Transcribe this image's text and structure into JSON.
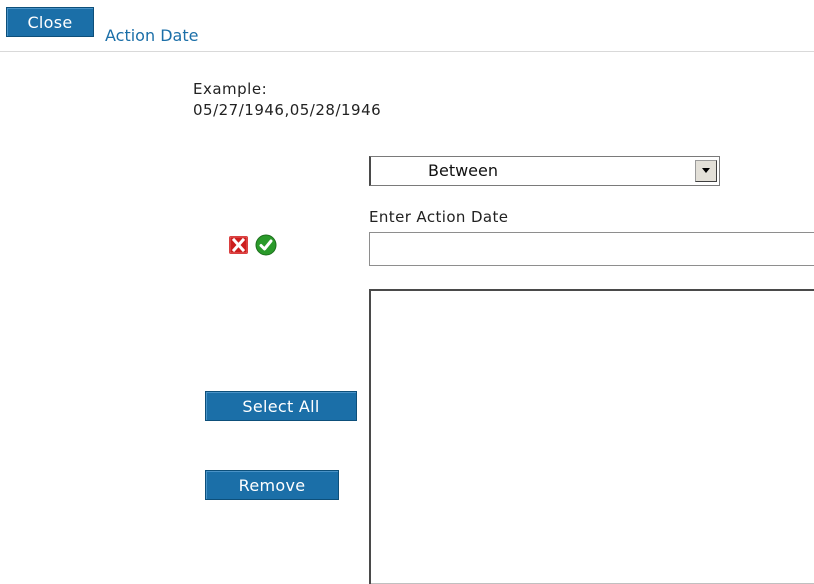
{
  "header": {
    "close_label": "Close",
    "title": "Action Date"
  },
  "filter": {
    "example_line1": "Example:",
    "example_line2": "05/27/1946,05/28/1946",
    "operator_selected": "Between",
    "input_label": "Enter Action Date",
    "input_value": "",
    "input_placeholder": ""
  },
  "icons": {
    "clear": "close-icon",
    "confirm": "check-icon"
  },
  "list": {
    "items": []
  },
  "buttons": {
    "select_all_label": "Select All",
    "remove_label": "Remove"
  },
  "colors": {
    "accent": "#1b6fa8",
    "clear_icon": "#cc1e1e",
    "confirm_icon": "#2a9a2a"
  }
}
